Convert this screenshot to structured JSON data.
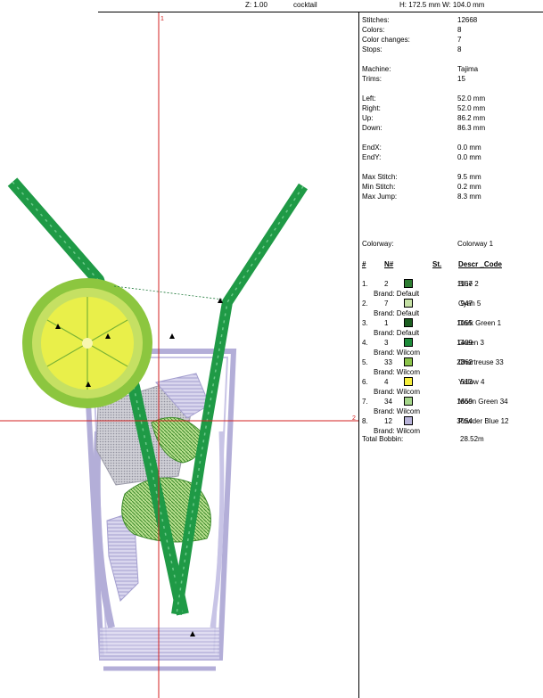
{
  "toolbar": {
    "zoom": "Z: 1.00",
    "design_name": "cocktail",
    "size": "H: 172.5 mm   W: 104.0 mm"
  },
  "canvas": {
    "axis_v_label": "1",
    "axis_h_label": "2"
  },
  "info": [
    {
      "label": "Stitches:",
      "value": "12668"
    },
    {
      "label": "Colors:",
      "value": "8"
    },
    {
      "label": "Color changes:",
      "value": "7"
    },
    {
      "label": "Stops:",
      "value": "8"
    },
    {
      "label": "Machine:",
      "value": "Tajima"
    },
    {
      "label": "Trims:",
      "value": "15"
    },
    {
      "label": "Left:",
      "value": "52.0 mm"
    },
    {
      "label": "Right:",
      "value": "52.0 mm"
    },
    {
      "label": "Up:",
      "value": "86.2 mm"
    },
    {
      "label": "Down:",
      "value": "86.3 mm"
    },
    {
      "label": "EndX:",
      "value": "0.0 mm"
    },
    {
      "label": "EndY:",
      "value": "0.0 mm"
    },
    {
      "label": "Max Stitch:",
      "value": "9.5 mm"
    },
    {
      "label": "Min Stitch:",
      "value": "0.2 mm"
    },
    {
      "label": "Max Jump:",
      "value": "8.3 mm"
    },
    {
      "label": "Colorway:",
      "value": "Colorway 1"
    }
  ],
  "table_headers": {
    "idx": "#",
    "num": "N#",
    "st": "St.",
    "desc": "Descr _Code"
  },
  "colors": [
    {
      "idx": "1.",
      "num": "2",
      "swatch": "#2e7d32",
      "stitches": "1157",
      "desc": "Blue 2",
      "brand": "Brand: Default"
    },
    {
      "idx": "2.",
      "num": "7",
      "swatch": "#c5e1a5",
      "stitches": "947",
      "desc": "Cyan 5",
      "brand": "Brand: Default"
    },
    {
      "idx": "3.",
      "num": "1",
      "swatch": "#1b5e20",
      "stitches": "1055",
      "desc": "Dark Green 1",
      "brand": "Brand: Default"
    },
    {
      "idx": "4.",
      "num": "3",
      "swatch": "#1e8c3a",
      "stitches": "1409",
      "desc": "Green 3",
      "brand": "Brand: Wilcom"
    },
    {
      "idx": "5.",
      "num": "33",
      "swatch": "#8bc34a",
      "stitches": "2862",
      "desc": "Chartreuse 33",
      "brand": "Brand: Wilcom"
    },
    {
      "idx": "6.",
      "num": "4",
      "swatch": "#f4ee3c",
      "stitches": "513",
      "desc": "Yellow 4",
      "brand": "Brand: Wilcom"
    },
    {
      "idx": "7.",
      "num": "34",
      "swatch": "#a5d68a",
      "stitches": "1659",
      "desc": "Moon Green 34",
      "brand": "Brand: Wilcom"
    },
    {
      "idx": "8.",
      "num": "12",
      "swatch": "#b7b2d8",
      "stitches": "3054",
      "desc": "Powder Blue 12",
      "brand": "Brand: Wilcom"
    }
  ],
  "bobbin": {
    "label": "Total Bobbin:",
    "value": "28.52m"
  }
}
